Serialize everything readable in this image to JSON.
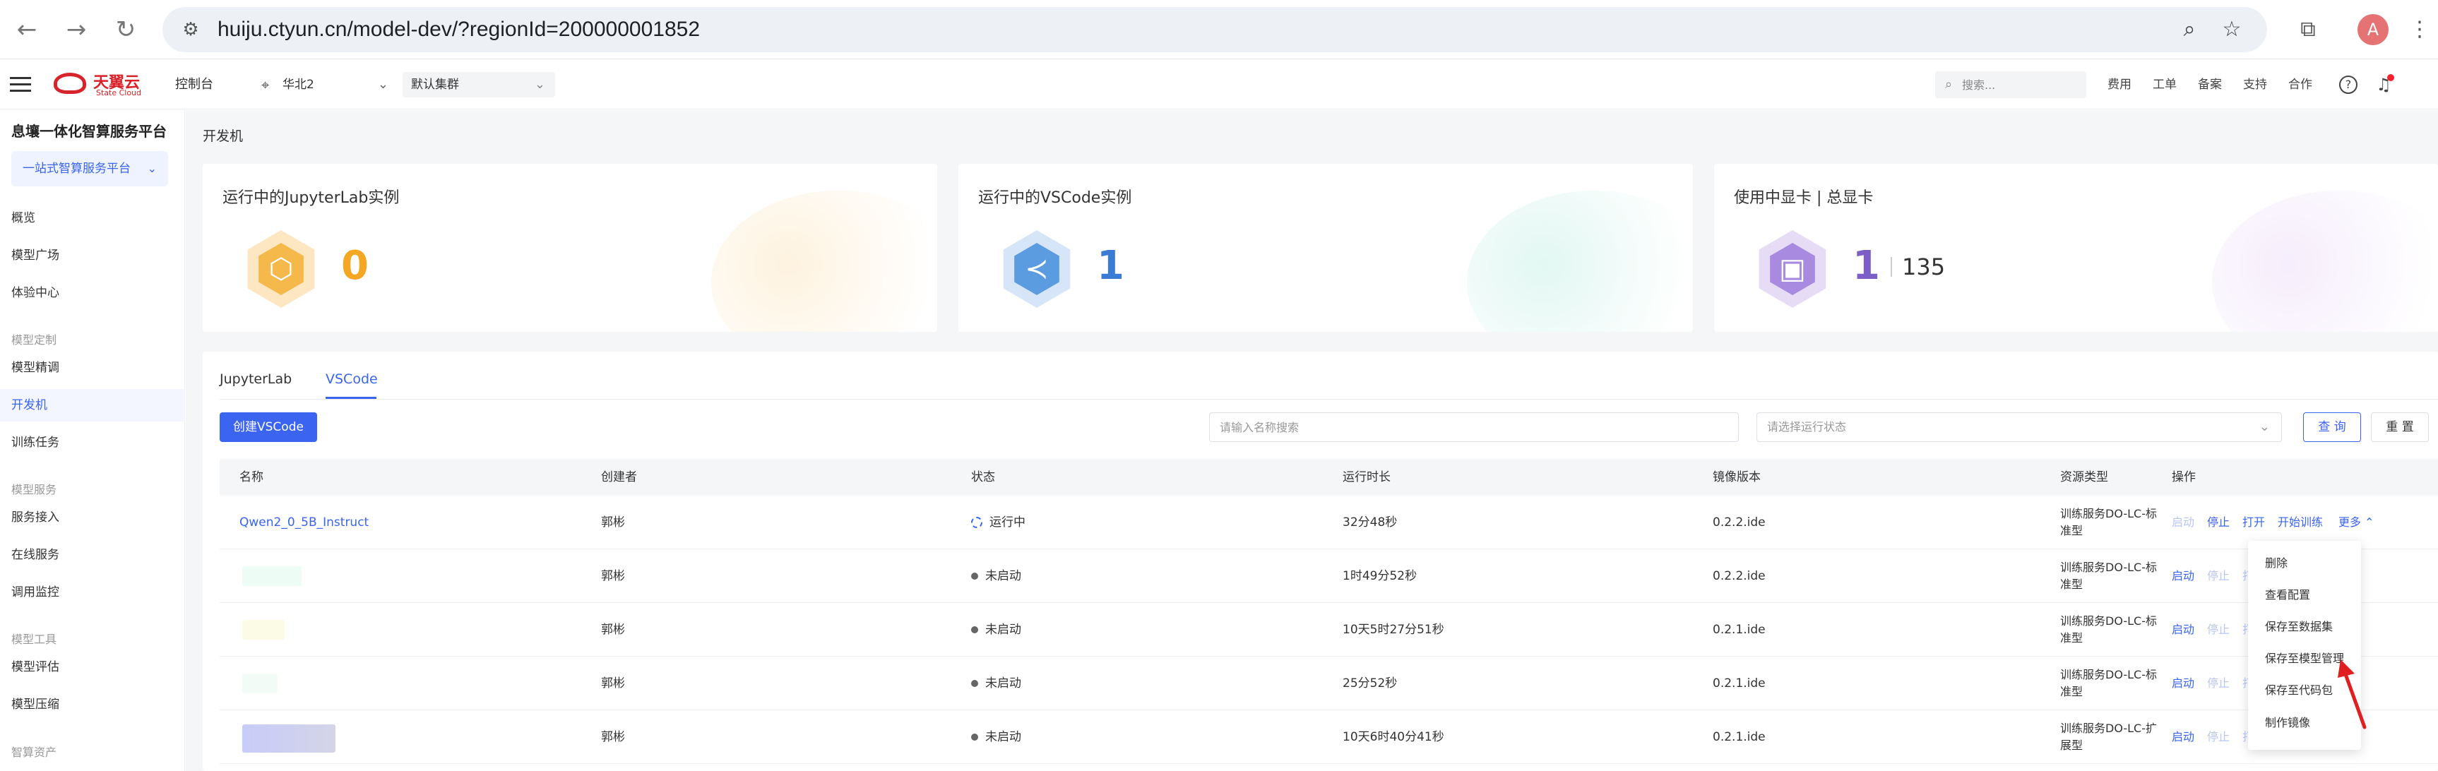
{
  "browser": {
    "url": "huiju.ctyun.cn/model-dev/?regionId=200000001852",
    "avatar_letter": "A"
  },
  "header": {
    "brand": "天翼云",
    "brand_sub": "State Cloud",
    "console": "控制台",
    "region": "华北2",
    "cluster": "默认集群",
    "search_placeholder": "搜索...",
    "links": [
      "费用",
      "工单",
      "备案",
      "支持",
      "合作"
    ]
  },
  "sidebar": {
    "title": "息壤一体化智算服务平台",
    "platform": "一站式智算服务平台",
    "items": [
      {
        "label": "概览"
      },
      {
        "label": "模型广场"
      },
      {
        "label": "体验中心"
      },
      {
        "group": "模型定制"
      },
      {
        "label": "模型精调"
      },
      {
        "label": "开发机",
        "active": true
      },
      {
        "label": "训练任务"
      },
      {
        "group": "模型服务"
      },
      {
        "label": "服务接入"
      },
      {
        "label": "在线服务"
      },
      {
        "label": "调用监控"
      },
      {
        "group": "模型工具"
      },
      {
        "label": "模型评估"
      },
      {
        "label": "模型压缩"
      },
      {
        "group": "智算资产"
      }
    ]
  },
  "page": {
    "title": "开发机"
  },
  "stats": [
    {
      "label": "运行中的JupyterLab实例",
      "value": "0",
      "color": "#f5a623"
    },
    {
      "label": "运行中的VSCode实例",
      "value": "1",
      "color": "#3a7bd5"
    },
    {
      "label": "使用中显卡 | 总显卡",
      "value": "1",
      "total": "135",
      "color": "#7b5fc7"
    }
  ],
  "tabs": [
    "JupyterLab",
    "VSCode"
  ],
  "toolbar": {
    "create_label": "创建VSCode",
    "name_placeholder": "请输入名称搜索",
    "status_placeholder": "请选择运行状态",
    "query_label": "查 询",
    "reset_label": "重 置"
  },
  "table": {
    "columns": [
      "名称",
      "创建者",
      "状态",
      "运行时长",
      "镜像版本",
      "资源类型",
      "操作"
    ],
    "rows": [
      {
        "name": "Qwen2_0_5B_Instruct",
        "creator": "郭彬",
        "status": "运行中",
        "running": true,
        "duration": "32分48秒",
        "image": "0.2.2.ide",
        "resource": "训练服务DO-LC-标准型"
      },
      {
        "name": "",
        "creator": "郭彬",
        "status": "未启动",
        "running": false,
        "duration": "1时49分52秒",
        "image": "0.2.2.ide",
        "resource": "训练服务DO-LC-标准型"
      },
      {
        "name": "",
        "creator": "郭彬",
        "status": "未启动",
        "running": false,
        "duration": "10天5时27分51秒",
        "image": "0.2.1.ide",
        "resource": "训练服务DO-LC-标准型"
      },
      {
        "name": "",
        "creator": "郭彬",
        "status": "未启动",
        "running": false,
        "duration": "25分52秒",
        "image": "0.2.1.ide",
        "resource": "训练服务DO-LC-标准型"
      },
      {
        "name": "",
        "creator": "郭彬",
        "status": "未启动",
        "running": false,
        "duration": "10天6时40分41秒",
        "image": "0.2.1.ide",
        "resource": "训练服务DO-LC-扩展型"
      }
    ],
    "actions": {
      "start": "启动",
      "stop": "停止",
      "open": "打开",
      "train": "开始训练",
      "more": "更多"
    }
  },
  "more_menu": [
    "删除",
    "查看配置",
    "保存至数据集",
    "保存至模型管理",
    "保存至代码包",
    "制作镜像"
  ]
}
